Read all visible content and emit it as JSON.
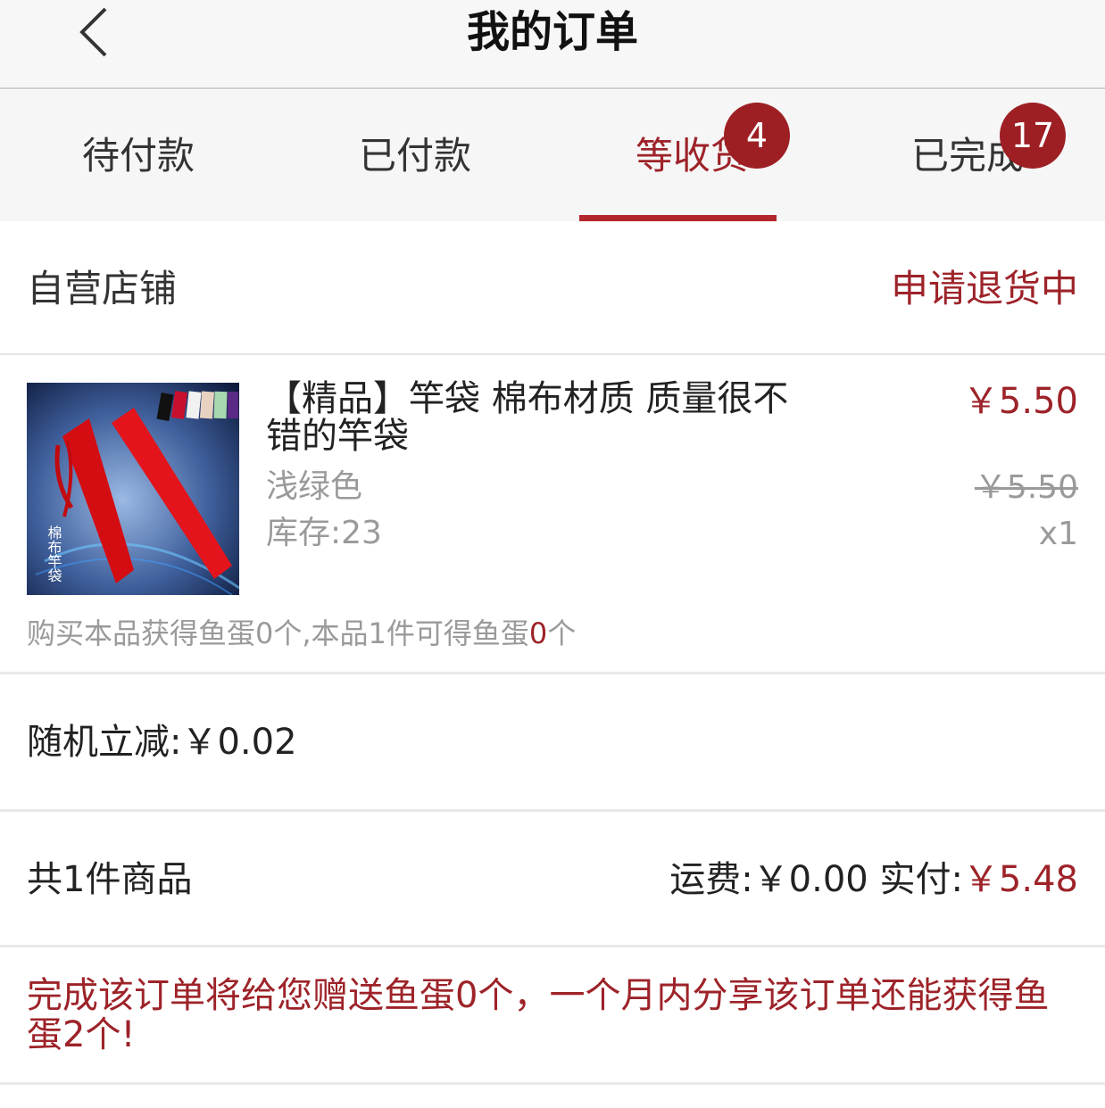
{
  "header": {
    "title": "我的订单",
    "back_icon": "chevron-left-icon"
  },
  "tabs": [
    {
      "label": "待付款"
    },
    {
      "label": "已付款"
    },
    {
      "label": "等收货",
      "badge": "4",
      "active": true
    },
    {
      "label": "已完成",
      "badge": "17"
    }
  ],
  "colors": {
    "accent": "#9d2329",
    "badge": "#9d1f24",
    "muted": "#9a9a9a"
  },
  "order": {
    "shop_name": "自营店铺",
    "status": "申请退货中",
    "product": {
      "thumb_text": "棉布竿袋",
      "title": "【精品】竿袋  棉布材质 质量很不错的竿袋",
      "spec": "浅绿色",
      "stock": "库存:23",
      "price": "￥5.50",
      "original_price": "￥5.50",
      "quantity": "x1",
      "reward_prefix": "购买本品获得鱼蛋0个,本品1件可得鱼蛋",
      "reward_value": "0",
      "reward_suffix": "个"
    },
    "discount": "随机立减:￥0.02",
    "item_count": "共1件商品",
    "shipping_label": "运费:￥0.00 实付:",
    "paid_amount": "￥5.48",
    "promo": "完成该订单将给您赠送鱼蛋0个，一个月内分享该订单还能获得鱼蛋2个!"
  }
}
